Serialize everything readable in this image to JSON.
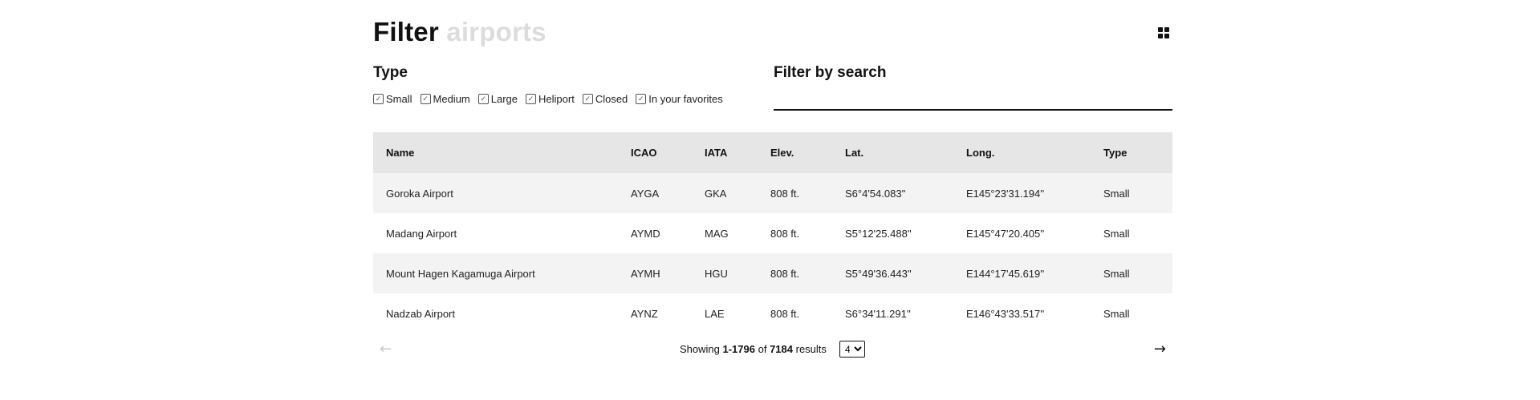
{
  "header": {
    "title_word1": "Filter",
    "title_word2": "airports",
    "view_icon": "grid-icon"
  },
  "type_filter": {
    "title": "Type",
    "options": [
      {
        "label": "Small",
        "checked": true
      },
      {
        "label": "Medium",
        "checked": true
      },
      {
        "label": "Large",
        "checked": true
      },
      {
        "label": "Heliport",
        "checked": true
      },
      {
        "label": "Closed",
        "checked": true
      },
      {
        "label": "In your favorites",
        "checked": true
      }
    ]
  },
  "search": {
    "title": "Filter by search",
    "value": "",
    "placeholder": ""
  },
  "table": {
    "columns": [
      "Name",
      "ICAO",
      "IATA",
      "Elev.",
      "Lat.",
      "Long.",
      "Type"
    ],
    "rows": [
      [
        "Goroka Airport",
        "AYGA",
        "GKA",
        "808 ft.",
        "S6°4'54.083''",
        "E145°23'31.194''",
        "Small"
      ],
      [
        "Madang Airport",
        "AYMD",
        "MAG",
        "808 ft.",
        "S5°12'25.488''",
        "E145°47'20.405''",
        "Small"
      ],
      [
        "Mount Hagen Kagamuga Airport",
        "AYMH",
        "HGU",
        "808 ft.",
        "S5°49'36.443''",
        "E144°17'45.619''",
        "Small"
      ],
      [
        "Nadzab Airport",
        "AYNZ",
        "LAE",
        "808 ft.",
        "S6°34'11.291''",
        "E146°43'33.517''",
        "Small"
      ]
    ]
  },
  "pagination": {
    "showing_label": "Showing",
    "range": "1-1796",
    "of_label": "of",
    "total": "7184",
    "results_label": "results",
    "page_selected": "4",
    "prev_icon": "arrow-left-icon",
    "next_icon": "arrow-right-icon",
    "prev_glyph": "←",
    "next_glyph": "→"
  }
}
